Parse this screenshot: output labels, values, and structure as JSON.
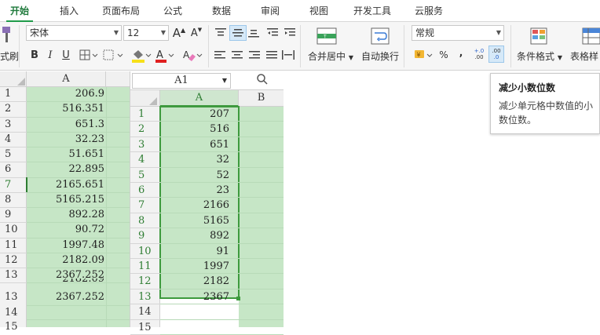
{
  "tabs": [
    "开始",
    "插入",
    "页面布局",
    "公式",
    "数据",
    "审阅",
    "视图",
    "开发工具",
    "云服务"
  ],
  "ribbon": {
    "format_painter_label": "式刷",
    "font_name": "宋体",
    "font_size": "12",
    "grow_font": "A",
    "shrink_font": "A",
    "bold": "B",
    "italic": "I",
    "underline": "U",
    "merge_center_label": "合并居中",
    "wrap_text_label": "自动换行",
    "number_format": "常规",
    "percent_label": "%",
    "comma_label": "000",
    "increase_decimal": "+.0 .00",
    "decrease_decimal": ".00 .0",
    "conditional_format_label": "条件格式",
    "table_style_label": "表格样"
  },
  "tooltip": {
    "title": "减少小数位数",
    "body": "减少单元格中数值的小数位数。"
  },
  "left_sheet": {
    "column_header": "A",
    "rows": [
      {
        "n": "1",
        "v": "206.9"
      },
      {
        "n": "2",
        "v": "516.351"
      },
      {
        "n": "3",
        "v": "651.3"
      },
      {
        "n": "4",
        "v": "32.23"
      },
      {
        "n": "5",
        "v": "51.651"
      },
      {
        "n": "6",
        "v": "22.895"
      },
      {
        "n": "7",
        "v": "2165.651"
      },
      {
        "n": "8",
        "v": "5165.215"
      },
      {
        "n": "9",
        "v": "892.28"
      },
      {
        "n": "10",
        "v": "90.72"
      },
      {
        "n": "11",
        "v": "1997.48"
      },
      {
        "n": "12",
        "v": "2182.09"
      },
      {
        "n": "13",
        "v": "2367.252"
      }
    ],
    "overlap_partial": "2182.09",
    "dup_row_num": "13",
    "dup_row_val": "2367.252",
    "row14": "14",
    "row15": "15"
  },
  "right_sheet": {
    "name_box": "A1",
    "col_a": "A",
    "col_b": "B",
    "rows": [
      {
        "n": "1",
        "v": "207"
      },
      {
        "n": "2",
        "v": "516"
      },
      {
        "n": "3",
        "v": "651"
      },
      {
        "n": "4",
        "v": "32"
      },
      {
        "n": "5",
        "v": "52"
      },
      {
        "n": "6",
        "v": "23"
      },
      {
        "n": "7",
        "v": "2166"
      },
      {
        "n": "8",
        "v": "5165"
      },
      {
        "n": "9",
        "v": "892"
      },
      {
        "n": "10",
        "v": "91"
      },
      {
        "n": "11",
        "v": "1997"
      },
      {
        "n": "12",
        "v": "2182"
      },
      {
        "n": "13",
        "v": "2367"
      }
    ],
    "row14": "14",
    "row15": "15"
  },
  "colors": {
    "accent_green": "#1f9b4a",
    "selection_fill": "#c6e6c6",
    "selection_border": "#3e9a3e"
  }
}
